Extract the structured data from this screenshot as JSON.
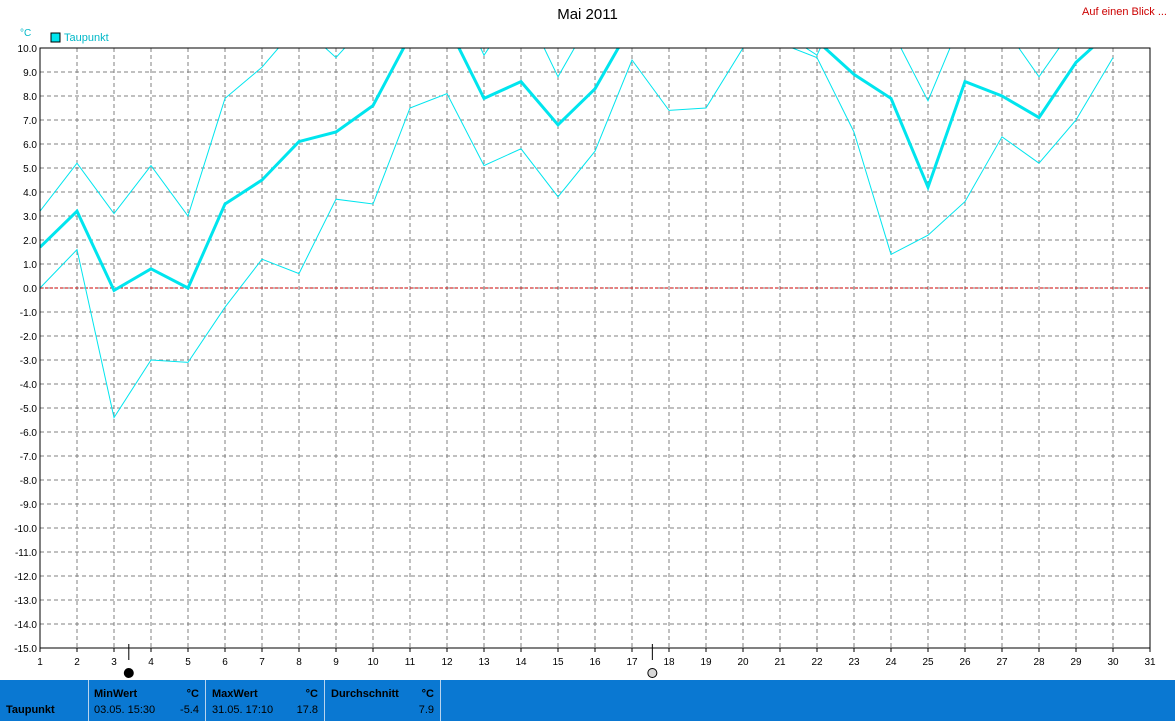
{
  "header": {
    "title": "Mai 2011",
    "link": "Auf einen Blick ..."
  },
  "legend": {
    "label": "Taupunkt",
    "color": "#00e5ee"
  },
  "footer": {
    "series": "Taupunkt",
    "min": {
      "label": "MinWert",
      "unit": "°C",
      "date": "03.05. 15:30",
      "value": "-5.4"
    },
    "max": {
      "label": "MaxWert",
      "unit": "°C",
      "date": "31.05. 17:10",
      "value": "17.8"
    },
    "avg": {
      "label": "Durchschnitt",
      "unit": "°C",
      "value": "7.9"
    }
  },
  "chart_data": {
    "type": "line",
    "ylabel": "°C",
    "ylim": [
      -15,
      10
    ],
    "yticks": [
      "10.0",
      "9.0",
      "8.0",
      "7.0",
      "6.0",
      "5.0",
      "4.0",
      "3.0",
      "2.0",
      "1.0",
      "0.0",
      "-1.0",
      "-2.0",
      "-3.0",
      "-4.0",
      "-5.0",
      "-6.0",
      "-7.0",
      "-8.0",
      "-9.0",
      "-10.0",
      "-11.0",
      "-12.0",
      "-13.0",
      "-14.0",
      "-15.0"
    ],
    "xticks": [
      "1",
      "2",
      "3",
      "4",
      "5",
      "6",
      "7",
      "8",
      "9",
      "10",
      "11",
      "12",
      "13",
      "14",
      "15",
      "16",
      "17",
      "18",
      "19",
      "20",
      "21",
      "22",
      "23",
      "24",
      "25",
      "26",
      "27",
      "28",
      "29",
      "30",
      "31"
    ],
    "xlim": [
      1,
      31
    ],
    "grid": true,
    "zero_line_color": "#cc0000",
    "series_color": "#00e5ee",
    "series": [
      {
        "name": "Taupunkt",
        "role": "max",
        "x": [
          1,
          2,
          3,
          4,
          5,
          6,
          7,
          8,
          9,
          10,
          11,
          12,
          13,
          14,
          15,
          16,
          17,
          18,
          19,
          20,
          21,
          22,
          23,
          24,
          25,
          26,
          27,
          28,
          29,
          30
        ],
        "values": [
          3.2,
          5.2,
          3.1,
          5.1,
          3.0,
          7.9,
          9.2,
          11.0,
          9.6,
          11.3,
          12.0,
          13.0,
          9.7,
          12.0,
          8.8,
          11.5,
          12.5,
          11.0,
          10.8,
          11.5,
          10.7,
          9.7,
          13.0,
          10.8,
          7.8,
          11.5,
          11.0,
          8.8,
          11.0,
          12.0
        ]
      },
      {
        "name": "Taupunkt",
        "role": "avg",
        "x": [
          1,
          2,
          3,
          4,
          5,
          6,
          7,
          8,
          9,
          10,
          11,
          12,
          13,
          14,
          15,
          16,
          17,
          18,
          19,
          20,
          21,
          22,
          23,
          24,
          25,
          26,
          27,
          28,
          29,
          30
        ],
        "values": [
          1.7,
          3.2,
          -0.1,
          0.8,
          0.0,
          3.5,
          4.5,
          6.1,
          6.5,
          7.6,
          10.5,
          11.0,
          7.9,
          8.6,
          6.8,
          8.3,
          11.0,
          10.7,
          10.3,
          10.8,
          10.2,
          10.3,
          8.9,
          7.9,
          4.2,
          8.6,
          8.0,
          7.1,
          9.4,
          10.8
        ]
      },
      {
        "name": "Taupunkt",
        "role": "min",
        "x": [
          1,
          2,
          3,
          4,
          5,
          6,
          7,
          8,
          9,
          10,
          11,
          12,
          13,
          14,
          15,
          16,
          17,
          18,
          19,
          20,
          21,
          22,
          23,
          24,
          25,
          26,
          27,
          28,
          29,
          30
        ],
        "values": [
          0.0,
          1.6,
          -5.4,
          -3.0,
          -3.1,
          -0.8,
          1.2,
          0.6,
          3.7,
          3.5,
          7.5,
          8.1,
          5.1,
          5.8,
          3.8,
          5.7,
          9.5,
          7.4,
          7.5,
          10.0,
          10.2,
          9.6,
          6.5,
          1.4,
          2.2,
          3.6,
          6.3,
          5.2,
          7.0,
          9.6
        ]
      }
    ],
    "markers": [
      {
        "kind": "new-moon",
        "x": 3.4
      },
      {
        "kind": "full-moon",
        "x": 17.55
      }
    ]
  }
}
